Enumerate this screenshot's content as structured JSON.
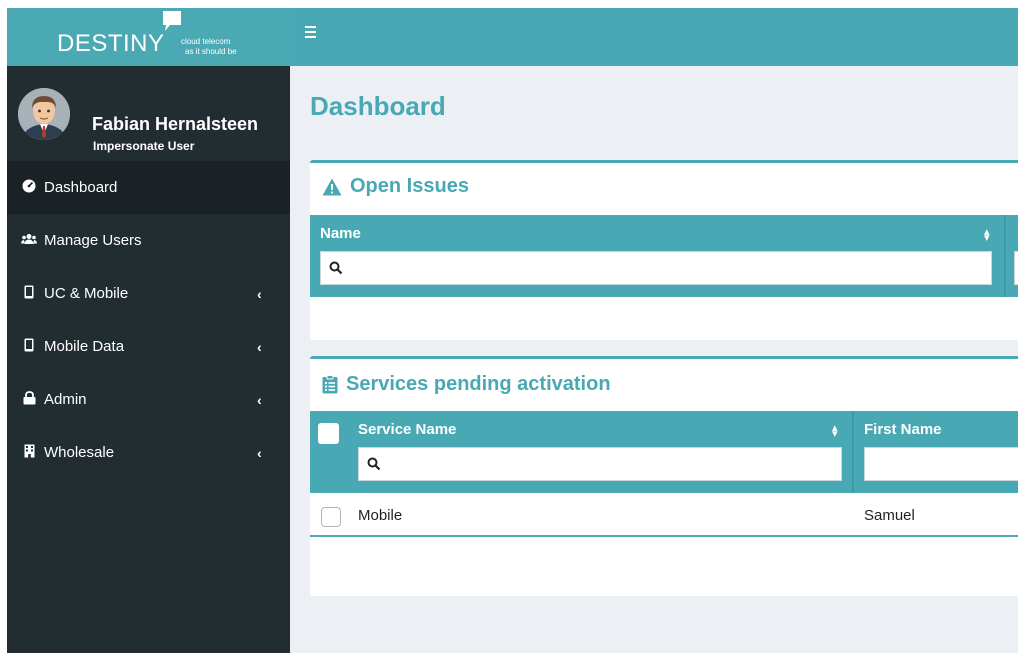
{
  "brand": {
    "name": "DESTINY",
    "tagline_line1": "cloud telecom",
    "tagline_line2": "as it should be",
    "header_color": "#48a9b4",
    "sidebar_color": "#222d32"
  },
  "user": {
    "name": "Fabian Hernalsteen",
    "subtitle": "Impersonate User"
  },
  "sidebar": {
    "items": [
      {
        "label": "Dashboard",
        "icon": "dashboard-gauge-icon",
        "glyph": "◕",
        "active": true,
        "has_children": false
      },
      {
        "label": "Manage Users",
        "icon": "users-icon",
        "glyph": "👥",
        "active": false,
        "has_children": false
      },
      {
        "label": "UC & Mobile",
        "icon": "mobile-phone-icon",
        "glyph": "▯",
        "active": false,
        "has_children": true
      },
      {
        "label": "Mobile Data",
        "icon": "mobile-phone-icon",
        "glyph": "▯",
        "active": false,
        "has_children": true
      },
      {
        "label": "Admin",
        "icon": "lock-icon",
        "glyph": "🔒",
        "active": false,
        "has_children": true
      },
      {
        "label": "Wholesale",
        "icon": "building-icon",
        "glyph": "▦",
        "active": false,
        "has_children": true
      }
    ],
    "chevron": "‹"
  },
  "page": {
    "title": "Dashboard"
  },
  "open_issues": {
    "title": "Open Issues",
    "icon": "warning-triangle-icon",
    "columns": [
      {
        "header": "Name",
        "search_value": ""
      }
    ],
    "rows": []
  },
  "services_pending": {
    "title": "Services pending activation",
    "icon": "clipboard-list-icon",
    "columns": [
      {
        "header": "Service Name",
        "search_value": ""
      },
      {
        "header": "First Name",
        "search_value": ""
      }
    ],
    "rows": [
      {
        "checked": false,
        "service_name": "Mobile",
        "first_name": "Samuel"
      }
    ]
  }
}
